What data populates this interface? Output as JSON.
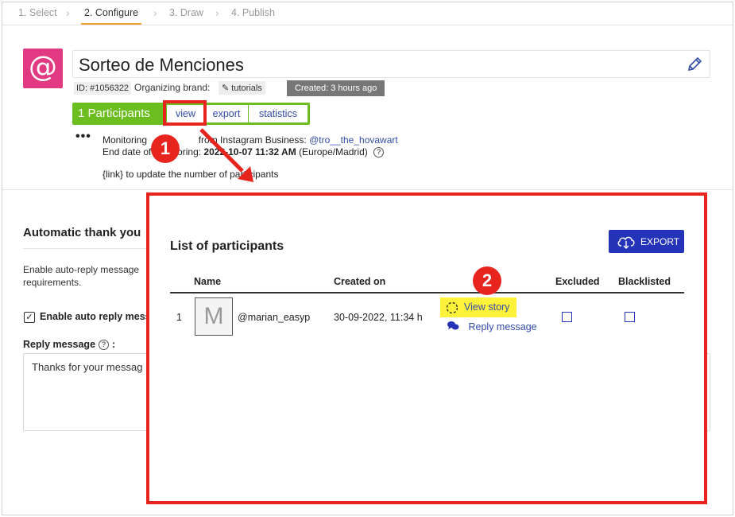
{
  "steps": [
    {
      "label": "1. Select"
    },
    {
      "label": "2. Configure"
    },
    {
      "label": "3. Draw"
    },
    {
      "label": "4. Publish"
    }
  ],
  "header": {
    "title": "Sorteo de Menciones",
    "id_tag": "ID: #1056322",
    "organizing_label": "Organizing brand:",
    "brand": "tutorials",
    "created": "Created: 3 hours ago"
  },
  "participants_bar": {
    "count_label": "1 Participants",
    "view_label": "view",
    "export_label": "export",
    "statistics_label": "statistics"
  },
  "monitoring": {
    "line1_prefix": "Monitoring",
    "line1_middle": "from Instagram Business:",
    "account": "@tro__the_hovawart",
    "line2_prefix": "End date of monitoring:",
    "end_date": "2022-10-07 11:32 AM",
    "timezone": "(Europe/Madrid)",
    "line3": "{link} to update the number of participants"
  },
  "auto_reply": {
    "title": "Automatic thank you",
    "description": "Enable auto-reply message requirements.",
    "enable_label": "Enable auto reply mess",
    "reply_label": "Reply message",
    "reply_text": "Thanks for your messag"
  },
  "popup": {
    "title": "List of participants",
    "export_label": "EXPORT",
    "columns": {
      "name": "Name",
      "created_on": "Created on",
      "excluded": "Excluded",
      "blacklisted": "Blacklisted"
    },
    "rows": [
      {
        "index": "1",
        "avatar_letter": "M",
        "handle": "@marian_easyp",
        "created_on": "30-09-2022, 11:34 h",
        "view_story": "View story",
        "reply_message": "Reply message"
      }
    ]
  },
  "annotations": {
    "one": "1",
    "two": "2",
    "color": "#e8241f"
  },
  "colors": {
    "accent": "#6cbd1f",
    "brand_pink": "#e23a82",
    "primary_blue": "#2433b8",
    "link": "#334ba8",
    "highlight": "#fff23a"
  }
}
